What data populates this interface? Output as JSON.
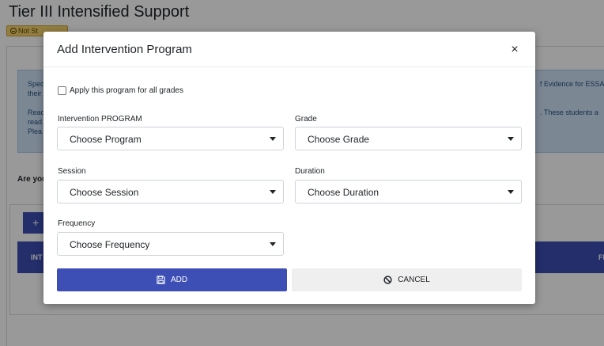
{
  "page": {
    "title": "Tier III Intensified Support",
    "status_badge": "Not St",
    "info": {
      "line1_left": "Spec",
      "line1_right": "f Evidence for ESSA",
      "line2_left": "their",
      "line3_left": "Reac",
      "line3_right": ". These students a",
      "line4_left": "read",
      "line5_left": "Plea"
    },
    "question": "Are you",
    "add_button": "+",
    "table_header": {
      "col1": "INT",
      "col2": "FI"
    }
  },
  "modal": {
    "title": "Add Intervention Program",
    "close_label": "×",
    "apply_all_label": "Apply this program for all grades",
    "fields": {
      "program": {
        "label": "Intervention PROGRAM",
        "value": "Choose Program"
      },
      "grade": {
        "label": "Grade",
        "value": "Choose Grade"
      },
      "session": {
        "label": "Session",
        "value": "Choose Session"
      },
      "duration": {
        "label": "Duration",
        "value": "Choose Duration"
      },
      "frequency": {
        "label": "Frequency",
        "value": "Choose Frequency"
      }
    },
    "add_label": "ADD",
    "cancel_label": "CANCEL"
  },
  "icons": {
    "close": "close-icon",
    "save": "save-icon",
    "cancel": "cancel-icon",
    "caret": "chevron-down-icon",
    "badge": "minus-circle-icon"
  },
  "colors": {
    "primary": "#3d4fb5",
    "badge": "#f3d36b",
    "info_bg": "#cfe2f7",
    "cancel_bg": "#efefef"
  }
}
